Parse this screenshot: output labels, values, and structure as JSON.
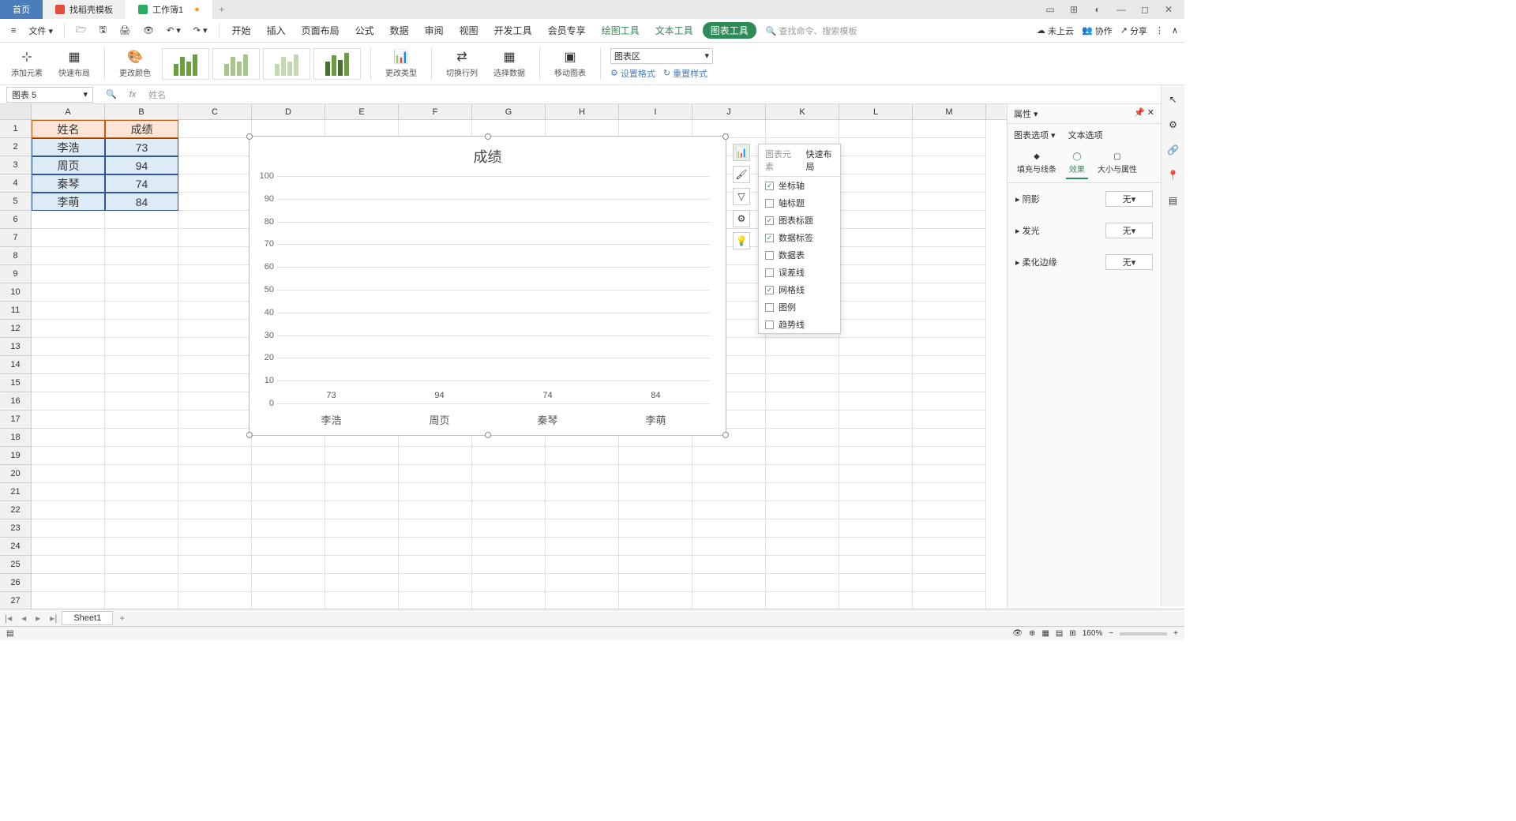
{
  "titlebar": {
    "home_tab": "首页",
    "template_tab": "找稻壳模板",
    "workbook_tab": "工作簿1",
    "add_tab": "+"
  },
  "menubar": {
    "file": "文件",
    "tabs": [
      "开始",
      "插入",
      "页面布局",
      "公式",
      "数据",
      "审阅",
      "视图",
      "开发工具",
      "会员专享"
    ],
    "draw_tools": "绘图工具",
    "text_tools": "文本工具",
    "chart_tools": "图表工具",
    "search_placeholder": "查找命令、搜索模板",
    "not_cloud": "未上云",
    "coop": "协作",
    "share": "分享"
  },
  "toolbar": {
    "add_element": "添加元素",
    "quick_layout": "快速布局",
    "change_color": "更改颜色",
    "change_type": "更改类型",
    "switch": "切换行列",
    "select_data": "选择数据",
    "move_chart": "移动图表",
    "chart_area": "图表区",
    "set_format": "设置格式",
    "reset_style": "重置样式"
  },
  "name_box": {
    "value": "图表 5"
  },
  "formula": {
    "placeholder": "姓名"
  },
  "columns": [
    "A",
    "B",
    "C",
    "D",
    "E",
    "F",
    "G",
    "H",
    "I",
    "J",
    "K",
    "L",
    "M"
  ],
  "table": {
    "header": {
      "name": "姓名",
      "score": "成绩"
    },
    "rows": [
      {
        "name": "李浩",
        "score": "73"
      },
      {
        "name": "周页",
        "score": "94"
      },
      {
        "name": "秦琴",
        "score": "74"
      },
      {
        "name": "李萌",
        "score": "84"
      }
    ]
  },
  "chart_data": {
    "type": "bar",
    "title": "成绩",
    "categories": [
      "李浩",
      "周页",
      "秦琴",
      "李萌"
    ],
    "values": [
      73,
      94,
      74,
      84
    ],
    "xlabel": "",
    "ylabel": "",
    "ylim": [
      0,
      100
    ],
    "ytick": 10
  },
  "chart_popup": {
    "tab_elements": "图表元素",
    "tab_layout": "快速布局",
    "items": [
      {
        "label": "坐标轴",
        "checked": true
      },
      {
        "label": "轴标题",
        "checked": false
      },
      {
        "label": "图表标题",
        "checked": true
      },
      {
        "label": "数据标签",
        "checked": true
      },
      {
        "label": "数据表",
        "checked": false
      },
      {
        "label": "误差线",
        "checked": false
      },
      {
        "label": "网格线",
        "checked": true
      },
      {
        "label": "图例",
        "checked": false
      },
      {
        "label": "趋势线",
        "checked": false
      }
    ]
  },
  "props": {
    "header": "属性",
    "chart_options": "图表选项",
    "text_options": "文本选项",
    "fill_line": "填充与线条",
    "effects": "效果",
    "size_props": "大小与属性",
    "shadow": "阴影",
    "glow": "发光",
    "soft_edge": "柔化边缘",
    "none": "无"
  },
  "sheet": {
    "name": "Sheet1"
  },
  "status": {
    "zoom": "160%"
  },
  "icons": {
    "cloud": "☁",
    "people": "👥",
    "share": "↗"
  }
}
